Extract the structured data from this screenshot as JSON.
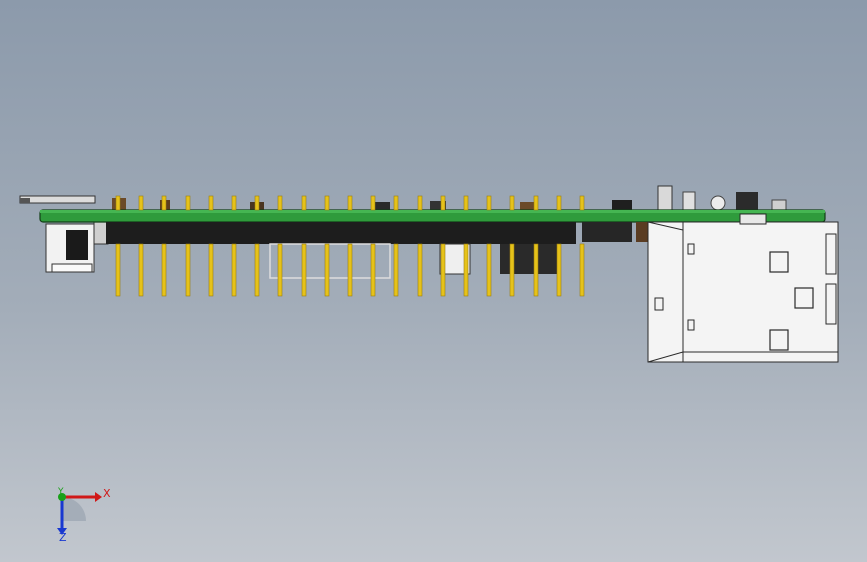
{
  "viewport": {
    "background_top": "#8c9aab",
    "background_bottom": "#c2c7ce"
  },
  "colors": {
    "pcb": "#2f9b3c",
    "pcb_edge": "#123e16",
    "header_body": "#1d1d1d",
    "pin": "#e6c21a",
    "pin_shade": "#9a7d10",
    "usb_shell": "#f4f4f4",
    "usb_outline": "#2a2a2a"
  },
  "triad": {
    "x_label": "X",
    "y_label": "Y",
    "z_label": "Z",
    "x_color": "#d01818",
    "y_color": "#18a018",
    "z_color": "#1838d0"
  }
}
